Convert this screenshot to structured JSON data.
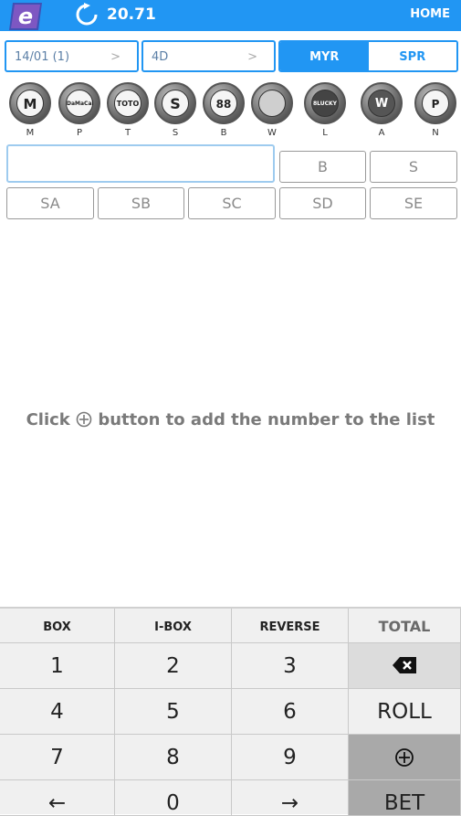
{
  "header": {
    "balance": "20.71",
    "home_label": "HOME",
    "bg_color": "#2196f3"
  },
  "selectors": {
    "date": "14/01 (1)",
    "game": "4D",
    "currency": [
      "MYR",
      "SPR"
    ],
    "currency_selected": "MYR"
  },
  "lotteries": [
    {
      "label": "M",
      "badge": "M",
      "icon": "magnum-logo-icon"
    },
    {
      "label": "P",
      "badge": "DaMaCai",
      "icon": "damacai-horse-logo-icon"
    },
    {
      "label": "T",
      "badge": "TOTO",
      "icon": "toto-logo-icon"
    },
    {
      "label": "S",
      "badge": "S",
      "icon": "singapore-pools-logo-icon"
    },
    {
      "label": "B",
      "badge": "88",
      "icon": "sabah88-logo-icon"
    },
    {
      "label": "W",
      "badge": "",
      "icon": "stc-logo-icon"
    },
    {
      "label": "L",
      "badge": "8LUCKY",
      "icon": "8lucky-logo-icon"
    },
    {
      "label": "A",
      "badge": "W",
      "icon": "wawasan-logo-icon"
    },
    {
      "label": "N",
      "badge": "P",
      "icon": "perdana-logo-icon"
    }
  ],
  "bet_types_row1": [
    "B",
    "S"
  ],
  "bet_types_row2": [
    "SA",
    "SB",
    "SC",
    "SD",
    "SE"
  ],
  "empty_message": {
    "before": "Click",
    "after": "button to add the number to the list",
    "icon": "circle-plus-icon"
  },
  "keypad": {
    "top": [
      "BOX",
      "I-BOX",
      "REVERSE",
      "TOTAL"
    ],
    "rows": [
      [
        "1",
        "2",
        "3"
      ],
      [
        "4",
        "5",
        "6"
      ],
      [
        "7",
        "8",
        "9"
      ],
      [
        "←",
        "0",
        "→"
      ]
    ],
    "side": [
      "backspace-icon",
      "ROLL",
      "add-icon",
      "BET"
    ]
  }
}
